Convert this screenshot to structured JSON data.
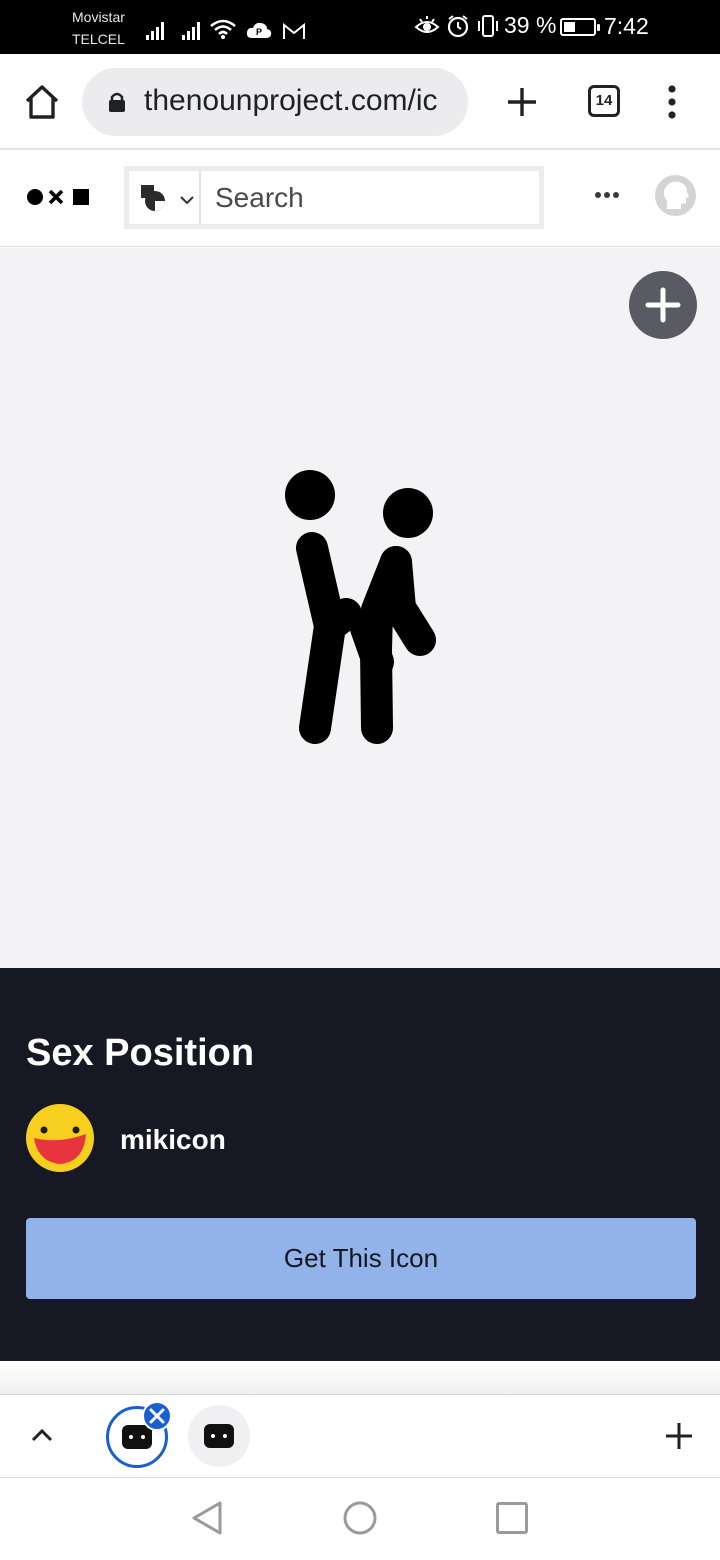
{
  "status_bar": {
    "carrier_1": "Movistar",
    "carrier_2": "TELCEL",
    "battery_percent_text": "39 %",
    "battery_level": 0.39,
    "time": "7:42",
    "icons": [
      "signal-icon",
      "signal-icon",
      "wifi-icon",
      "cloud-icon",
      "gmail-icon",
      "eye-icon",
      "alarm-icon",
      "vibrate-icon",
      "battery-icon"
    ]
  },
  "browser": {
    "url": "thenounproject.com/ic",
    "tab_count": "14"
  },
  "site_header": {
    "search_placeholder": "Search"
  },
  "icon_page": {
    "title": "Sex Position",
    "creator": "mikicon",
    "cta_label": "Get This Icon"
  },
  "colors": {
    "info_panel_bg": "#161924",
    "cta_bg": "#92b2ea",
    "preview_bg": "#f3f3f5",
    "active_tab_ring": "#1a5fd1"
  }
}
